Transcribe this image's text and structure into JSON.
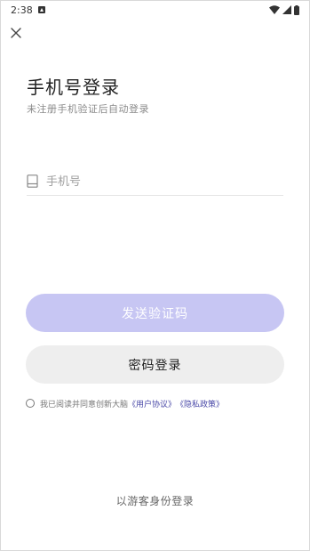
{
  "status_bar": {
    "time": "2:38",
    "notification_icon": "notification-a-icon",
    "icons": [
      "wifi-icon",
      "signal-icon",
      "battery-icon"
    ]
  },
  "header": {
    "close_icon": "close-icon"
  },
  "login": {
    "title": "手机号登录",
    "subtitle": "未注册手机验证后自动登录",
    "phone_placeholder": "手机号",
    "phone_value": "",
    "phone_icon": "phone-icon"
  },
  "buttons": {
    "send_code": "发送验证码",
    "password_login": "密码登录"
  },
  "agreement": {
    "prefix": "我已阅读并同意创新大脑",
    "user_agreement": "《用户协议》",
    "privacy_policy": "《隐私政策》",
    "checked": false
  },
  "guest_login": "以游客身份登录",
  "colors": {
    "send_button_bg": "#c7c6f3",
    "password_button_bg": "#eeeeee",
    "link": "#4b4aa8"
  }
}
